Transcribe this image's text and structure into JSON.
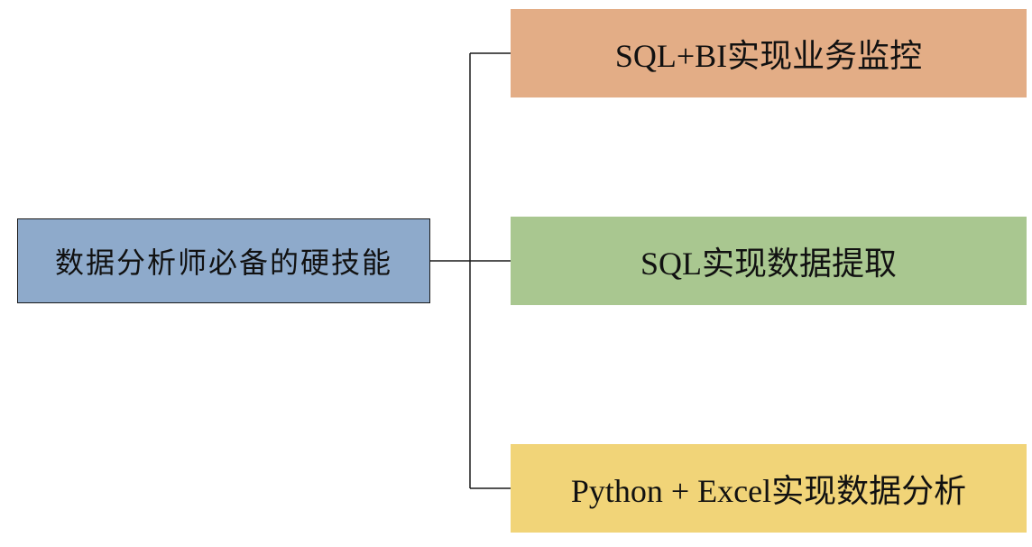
{
  "diagram": {
    "root": {
      "label": "数据分析师必备的硬技能",
      "color": "#8eaacb"
    },
    "children": [
      {
        "label": "SQL+BI实现业务监控",
        "color": "#e3ad86"
      },
      {
        "label": "SQL实现数据提取",
        "color": "#a9c790"
      },
      {
        "label": "Python + Excel实现数据分析",
        "color": "#f1d478"
      }
    ],
    "line_color": "#1a1a1a"
  }
}
